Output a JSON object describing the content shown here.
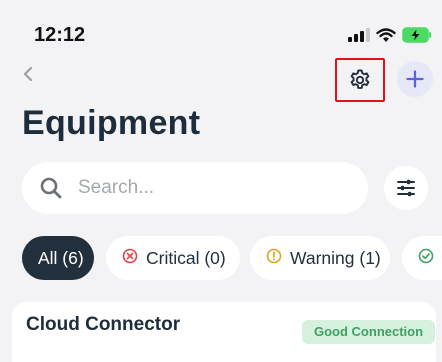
{
  "status_bar": {
    "time": "12:12"
  },
  "nav": {
    "back_icon": "chevron-left-icon",
    "settings_icon": "gear-icon",
    "add_icon": "plus-icon"
  },
  "page": {
    "title": "Equipment"
  },
  "search": {
    "placeholder": "Search...",
    "value": ""
  },
  "filters": [
    {
      "label": "All (6)",
      "active": true
    },
    {
      "label": "Critical (0)",
      "icon": "x-circle-icon",
      "color": "#e0414b"
    },
    {
      "label": "Warning (1)",
      "icon": "exclamation-circle-icon",
      "color": "#e0a11b"
    },
    {
      "label": "",
      "icon": "check-circle-icon",
      "color": "#3fa063"
    }
  ],
  "equipment": [
    {
      "name": "Cloud Connector",
      "status": "Good Connection"
    }
  ],
  "colors": {
    "accent": "#5a63d8",
    "highlight_box": "#e0121b",
    "dark": "#22303e"
  }
}
